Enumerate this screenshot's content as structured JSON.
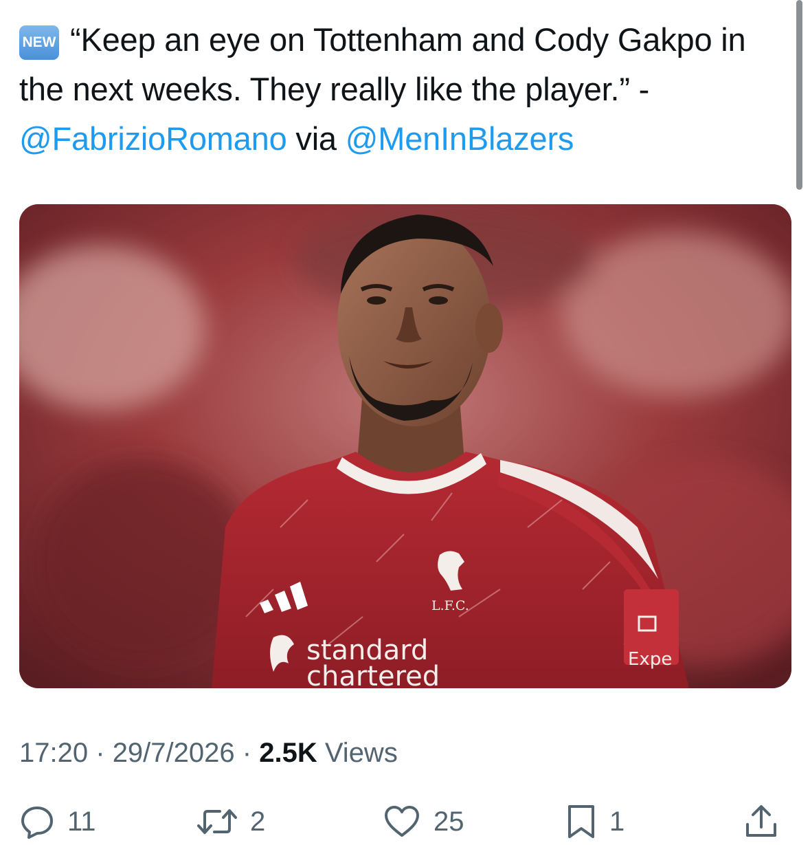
{
  "tweet": {
    "badge": "NEW",
    "badge_icon": "new-button-emoji",
    "quote": "“Keep an eye on Tottenham and Cody Gakpo in the next weeks. They really like the player.” -",
    "mention_1": "@FabrizioRomano",
    "via": "via",
    "mention_2": "@MenInBlazers"
  },
  "media": {
    "kit_logos": {
      "crest_text": "L.F.C.",
      "sponsor_line_1": "standard",
      "sponsor_line_2": "chartered",
      "sleeve_text": "Expe"
    }
  },
  "meta": {
    "time": "17:20",
    "sep_1": "·",
    "date": "29/7/2026",
    "sep_2": "·",
    "views_count": "2.5K",
    "views_label": "Views"
  },
  "actions": {
    "replies": "11",
    "retweets": "2",
    "likes": "25",
    "bookmarks": "1"
  },
  "colors": {
    "link": "#1d9bf0",
    "text": "#0f1419",
    "muted": "#536471",
    "kit_red": "#b0262f"
  }
}
